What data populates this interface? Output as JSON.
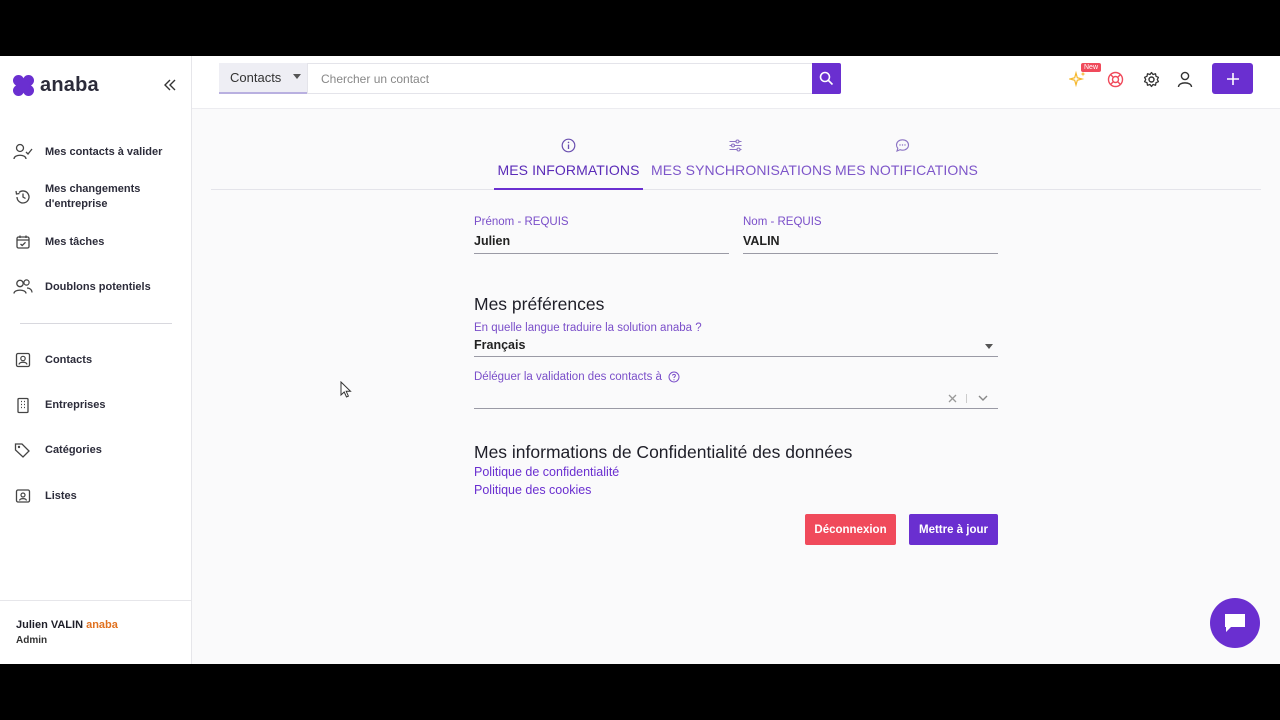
{
  "brand": {
    "name": "anaba",
    "accent": "#6a2fd0"
  },
  "sidebar": {
    "items": [
      {
        "label": "Mes contacts à valider",
        "icon": "user-check-icon"
      },
      {
        "label": "Mes changements d'entreprise",
        "icon": "history-icon"
      },
      {
        "label": "Mes tâches",
        "icon": "calendar-check-icon"
      },
      {
        "label": "Doublons potentiels",
        "icon": "users-icon"
      },
      {
        "label": "Contacts",
        "icon": "contact-card-icon"
      },
      {
        "label": "Entreprises",
        "icon": "building-icon"
      },
      {
        "label": "Catégories",
        "icon": "tags-icon"
      },
      {
        "label": "Listes",
        "icon": "list-folder-icon"
      }
    ],
    "user": {
      "name": "Julien VALIN",
      "brand": "anaba",
      "role": "Admin"
    }
  },
  "topbar": {
    "scope": "Contacts",
    "search_placeholder": "Chercher un contact",
    "new_badge": "New"
  },
  "tabs": [
    {
      "label": "MES INFORMATIONS",
      "icon": "info-icon",
      "active": true
    },
    {
      "label": "MES SYNCHRONISATIONS",
      "icon": "sliders-icon",
      "active": false
    },
    {
      "label": "MES NOTIFICATIONS",
      "icon": "chat-bubble-icon",
      "active": false
    }
  ],
  "form": {
    "firstname_label": "Prénom - REQUIS",
    "firstname_value": "Julien",
    "lastname_label": "Nom - REQUIS",
    "lastname_value": "VALIN",
    "prefs_title": "Mes préférences",
    "language_label": "En quelle langue traduire la solution anaba ?",
    "language_value": "Français",
    "delegate_label": "Déléguer la validation des contacts à",
    "privacy_title": "Mes informations de Confidentialité des données",
    "privacy_link": "Politique de confidentialité",
    "cookies_link": "Politique des cookies",
    "logout_label": "Déconnexion",
    "update_label": "Mettre à jour"
  },
  "colors": {
    "logout": "#f04a5b",
    "update": "#6a2fd0"
  }
}
